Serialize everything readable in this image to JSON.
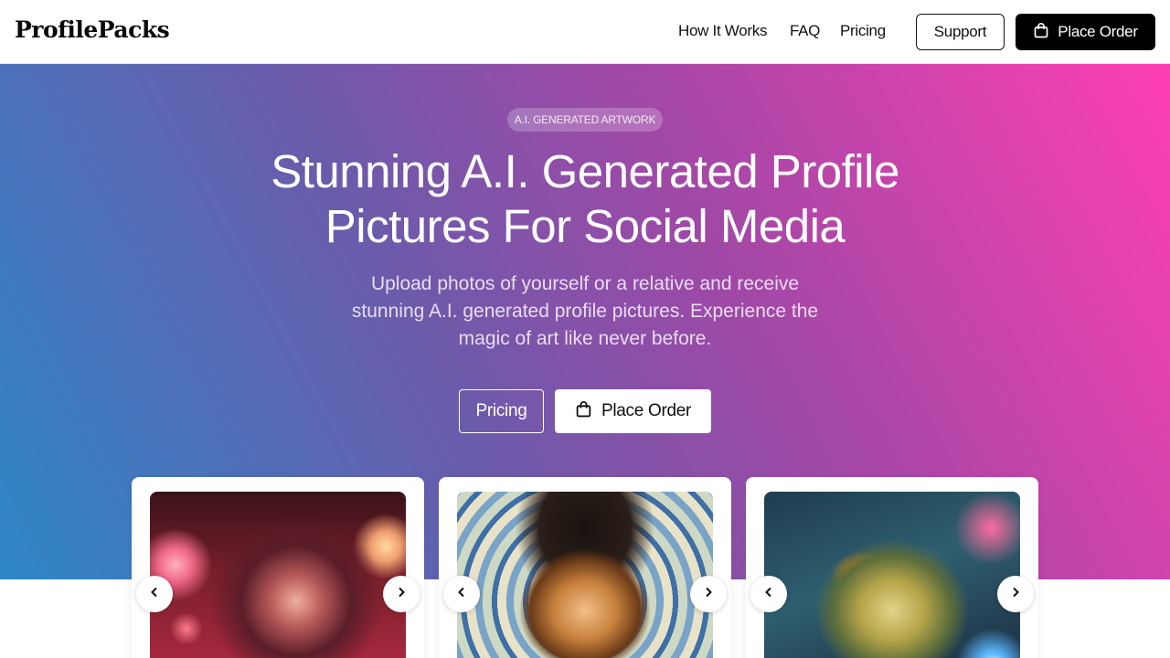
{
  "header": {
    "logo": "ProfilePacks",
    "nav": [
      "How It Works",
      "FAQ",
      "Pricing"
    ],
    "support_label": "Support",
    "order_label": "Place Order"
  },
  "hero": {
    "badge": "A.I. GENERATED ARTWORK",
    "title_line1": "Stunning A.I. Generated Profile",
    "title_line2": "Pictures For Social Media",
    "subtitle": "Upload photos of yourself or a relative and receive stunning A.I. generated profile pictures. Experience the magic of art like never before.",
    "pricing_label": "Pricing",
    "order_label": "Place Order"
  },
  "colors": {
    "gradient_start": "#2d87c8",
    "gradient_mid": "#a148a6",
    "gradient_end": "#ff3fb3",
    "primary_button": "#000000"
  },
  "icons": {
    "bag": "shopping-bag-icon",
    "prev": "chevron-left-icon",
    "next": "chevron-right-icon"
  }
}
